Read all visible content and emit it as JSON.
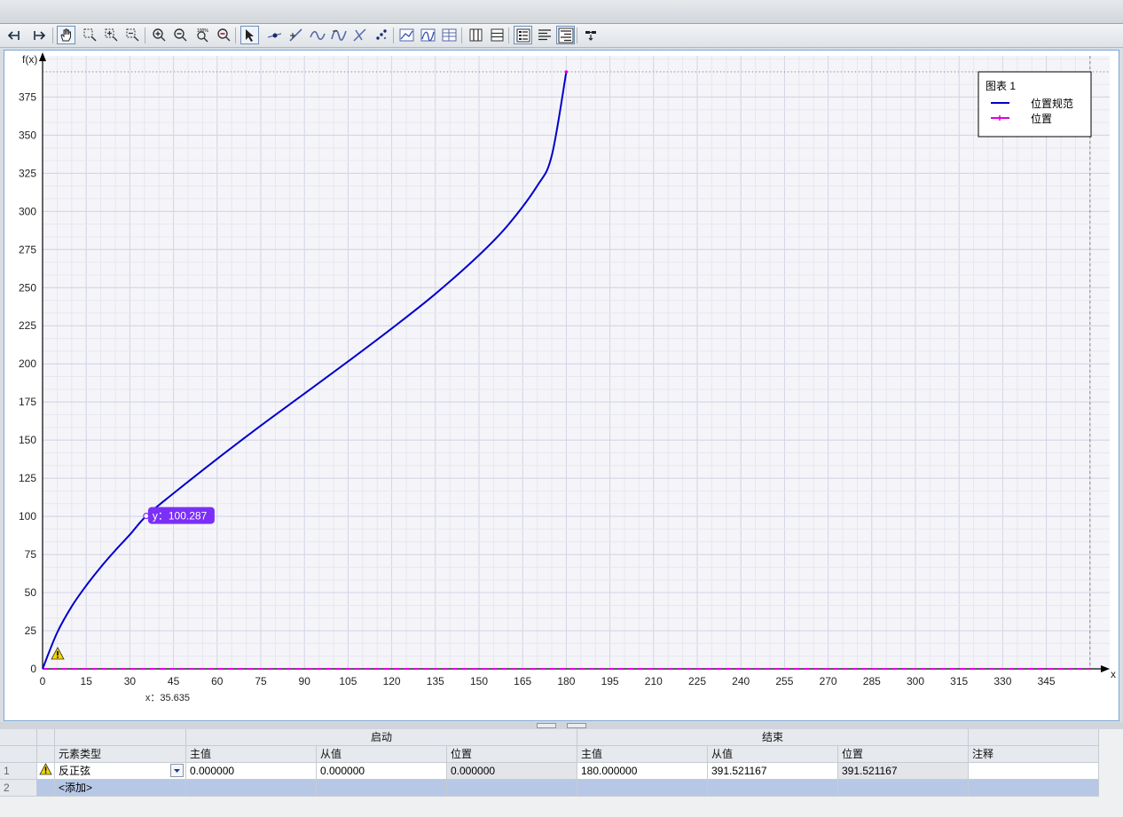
{
  "toolbar": {
    "buttons": [
      {
        "icon": "arrow-left-icon",
        "active": false
      },
      {
        "icon": "arrow-right-icon",
        "active": false
      },
      {
        "icon": "hand-pan-icon",
        "active": true
      },
      {
        "icon": "zoom-box-icon",
        "active": false
      },
      {
        "icon": "zoom-box-plus-icon",
        "active": false
      },
      {
        "icon": "zoom-box-minus-icon",
        "active": false
      },
      {
        "icon": "zoom-in-icon",
        "active": false
      },
      {
        "icon": "zoom-out-icon",
        "active": false
      },
      {
        "icon": "zoom-100-icon",
        "active": false
      },
      {
        "icon": "zoom-fit-icon",
        "active": false
      },
      {
        "icon": "select-pointer-icon",
        "active": true
      },
      {
        "icon": "add-point-icon",
        "active": false
      },
      {
        "icon": "line-segment-icon",
        "active": false
      },
      {
        "icon": "sine-curve-icon",
        "active": false
      },
      {
        "icon": "curve-wave-icon",
        "active": false
      },
      {
        "icon": "inverse-line-icon",
        "active": false
      },
      {
        "icon": "point-grid-icon",
        "active": false
      },
      {
        "icon": "graph-view-icon",
        "active": false
      },
      {
        "icon": "graph-compare-icon",
        "active": false
      },
      {
        "icon": "graph-table-icon",
        "active": false
      },
      {
        "icon": "columns-icon",
        "active": false
      },
      {
        "icon": "rows-icon",
        "active": false
      },
      {
        "icon": "legend-list-icon",
        "active": true
      },
      {
        "icon": "align-left-icon",
        "active": false
      },
      {
        "icon": "align-right-icon",
        "active": true
      },
      {
        "icon": "measure-icon",
        "active": false
      }
    ]
  },
  "chart_data": {
    "type": "line",
    "ylabel": "f(x)",
    "xlabel": "x",
    "xlim": [
      0,
      360
    ],
    "ylim": [
      0,
      391.521167
    ],
    "x_ticks": [
      0,
      15,
      30,
      45,
      60,
      75,
      90,
      105,
      120,
      135,
      150,
      165,
      180,
      195,
      210,
      225,
      240,
      255,
      270,
      285,
      300,
      315,
      330,
      345
    ],
    "y_ticks": [
      0,
      25,
      50,
      75,
      100,
      125,
      150,
      175,
      200,
      225,
      250,
      275,
      300,
      325,
      350,
      375
    ],
    "grid": true,
    "legend": {
      "title": "图表 1",
      "position": "top-right",
      "entries": [
        {
          "label": "位置规范",
          "color": "#0000cc"
        },
        {
          "label": "位置",
          "color": "#e000e0"
        }
      ]
    },
    "series": [
      {
        "name": "位置规范",
        "type": "arcsine",
        "color": "#0000cc",
        "x": [
          0,
          5,
          10,
          15,
          20,
          25,
          30,
          35.635,
          45,
          60,
          75,
          90,
          105,
          120,
          135,
          150,
          160,
          170,
          175,
          180
        ],
        "y": [
          0,
          23.7,
          40.9,
          54.6,
          66.7,
          77.7,
          88.0,
          100.287,
          115.1,
          137.7,
          159.5,
          180.5,
          201.6,
          223.2,
          245.9,
          271.3,
          291.1,
          316.7,
          336.5,
          391.5
        ]
      },
      {
        "name": "位置",
        "color": "#e000e0",
        "x": [
          0,
          360
        ],
        "y": [
          0,
          0
        ]
      }
    ],
    "cursor": {
      "x_text": "x：35.635",
      "y_text": "y：100.287",
      "x": 35.635,
      "y": 100.287
    },
    "accent_tooltip": "#7b2ff7"
  },
  "table": {
    "group_headers": {
      "start": "启动",
      "end": "结束"
    },
    "columns": [
      "元素类型",
      "主值",
      "从值",
      "位置",
      "主值",
      "从值",
      "位置",
      "注释"
    ],
    "rows": [
      {
        "num": "1",
        "warning": true,
        "type": "反正弦",
        "start_master": "0.000000",
        "start_slave": "0.000000",
        "start_pos": "0.000000",
        "end_master": "180.000000",
        "end_slave": "391.521167",
        "end_pos": "391.521167",
        "comment": ""
      },
      {
        "num": "2",
        "warning": false,
        "type": "<添加>"
      }
    ]
  }
}
